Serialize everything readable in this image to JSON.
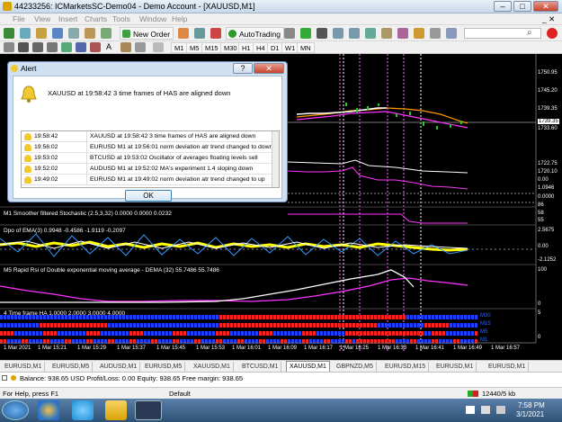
{
  "window": {
    "title": "44233256: ICMarketsSC-Demo04 - Demo Account - [XAUUSD,M1]"
  },
  "menu": [
    "File",
    "View",
    "Insert",
    "Charts",
    "Tools",
    "Window",
    "Help"
  ],
  "toolbar": {
    "new_order": "New Order",
    "autotrading": "AutoTrading"
  },
  "timeframes": [
    "M1",
    "M5",
    "M15",
    "M30",
    "H1",
    "H4",
    "D1",
    "W1",
    "MN"
  ],
  "chart": {
    "price_labels": [
      "1750.95",
      "1745.20",
      "1739.35",
      "1737.00",
      "1733.60",
      "1722.75",
      "1720.10"
    ],
    "current_price": "1739.35",
    "osc_labels": [
      "0.00",
      "1.0946",
      "0.0000",
      "86",
      "58",
      "55"
    ],
    "panels": {
      "stoch": "M1 Smoother filtered Stochastic (2.5,3,32) 0.0000 0.0000 0.0232",
      "dpo": "Dpo of EMA(3) 0.9948 -0.4586 -1.9119 -0.2097",
      "dpo_high": "2.5675",
      "dpo_mid": "0.00",
      "dpo_low": "-2.1252",
      "rsi": "M5 Rapid Rsi of Double exponential moving average - DEMA (32) 55.7486 55.7486",
      "rsi_high": "100",
      "rsi_low": "0",
      "ha": "4 Time frame HA 1.0000 2.0000 3.0000 4.0000",
      "ha_labels": [
        "M30",
        "M15",
        "M5",
        "M1"
      ],
      "ha_axis": [
        "5",
        "0"
      ]
    },
    "time_labels": [
      "1 Mar 2021",
      "1 Mar 15:21",
      "1 Mar 15:29",
      "1 Mar 15:37",
      "1 Mar 15:45",
      "1 Mar 15:53",
      "1 Mar 16:01",
      "1 Mar 16:09",
      "1 Mar 16:17",
      "1 Mar 16:25",
      "1 Mar 16:33",
      "1 Mar 16:41",
      "1 Mar 16:49",
      "1 Mar 16:57"
    ]
  },
  "alert": {
    "title": "Alert",
    "message": "XAUUSD at 19:58:42 3 time frames of HAS are aligned down",
    "rows": [
      {
        "time": "19:58:42",
        "msg": "XAUUSD at 19:58:42 3 time frames of HAS are aligned down"
      },
      {
        "time": "19:56:02",
        "msg": "EURUSD M1 at 19:56:01 norm deviation atr trend changed to down"
      },
      {
        "time": "19:53:02",
        "msg": "BTCUSD at 19:53:02 Oscillator of averages floating levels sell"
      },
      {
        "time": "19:52:02",
        "msg": "AUDUSD M1 at 19:52:02 MA's experiment 1.4 sloping down"
      },
      {
        "time": "19:49:02",
        "msg": "EURUSD M1 at 19:49:02 norm deviation atr trend changed to up"
      }
    ],
    "ok": "OK"
  },
  "tabs": [
    "EURUSD,M1",
    "EURUSD,M5",
    "AUDUSD,M1",
    "EURUSD,M5",
    "XAUUSD,M1",
    "BTCUSD,M1",
    "XAUUSD,M1",
    "GBPNZD,M5",
    "EURUSD,M15",
    "EURUSD,M1",
    "EURUSD,M1"
  ],
  "active_tab": 6,
  "terminal": {
    "text": "Balance: 938.65 USD  Profit/Loss: 0.00  Equity: 938.65  Free margin: 938.65"
  },
  "status": {
    "help": "For Help, press F1",
    "profile": "Default",
    "traffic": "12440/5 kb"
  },
  "tray": {
    "time": "7:58 PM",
    "date": "3/1/2021"
  },
  "colors": {
    "accent_alert": "#f2c830",
    "chart_bg": "#000000",
    "ha_red": "#ff2020",
    "ha_blue": "#2040ff"
  }
}
